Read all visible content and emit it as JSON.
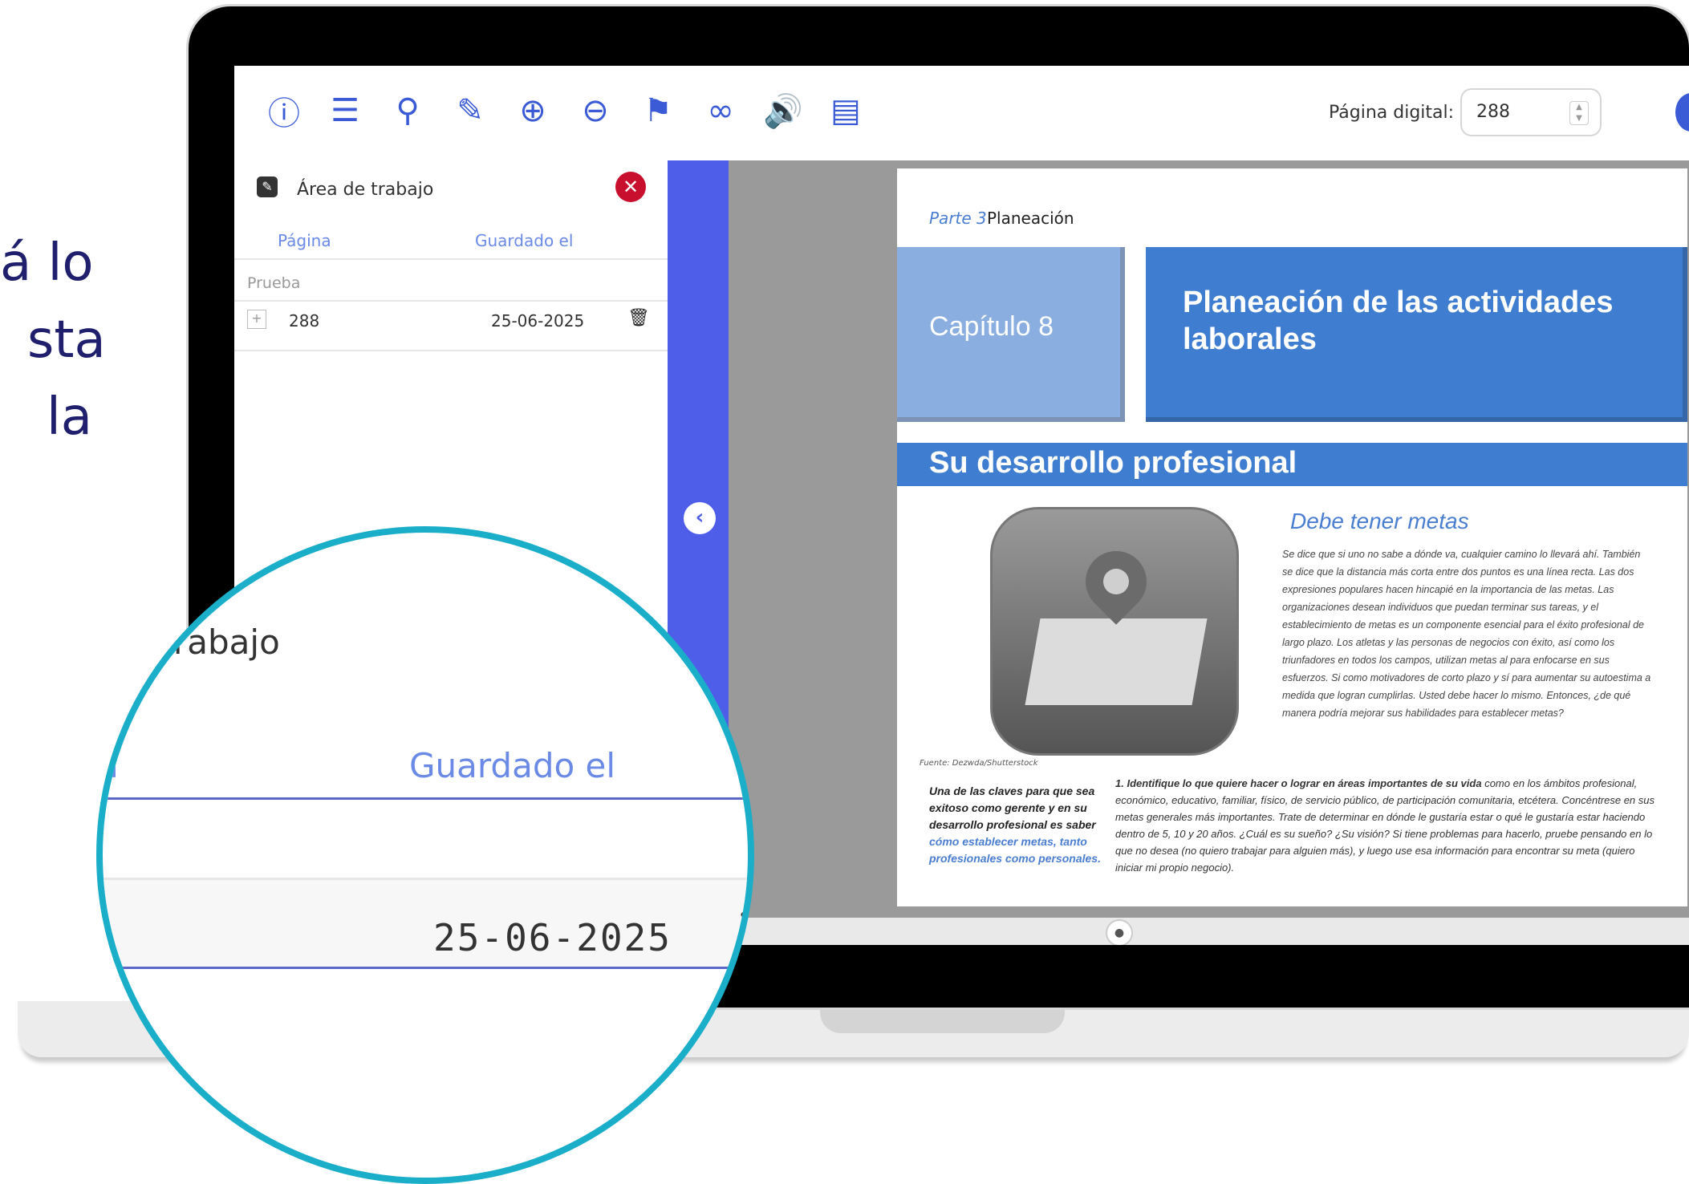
{
  "side_text": [
    "á lo",
    "sta",
    "la"
  ],
  "toolbar": {
    "icons": [
      "info-icon",
      "list-icon",
      "search-icon",
      "edit-icon",
      "zoom-in-icon",
      "zoom-out-icon",
      "bookmark-icon",
      "link-icon",
      "audio-icon",
      "translate-icon"
    ],
    "page_label": "Página digital:",
    "page_value": "288",
    "accent_color": "#3a5ad6"
  },
  "panel": {
    "title": "Área de trabajo",
    "col_page": "Página",
    "col_saved": "Guardado el",
    "group": "Prueba",
    "rows": [
      {
        "page": "288",
        "saved": "25-06-2025"
      }
    ],
    "strip_color": "#4f5ee8"
  },
  "book": {
    "parte": "Parte 3",
    "parte_sub": "Planeación",
    "chapter": "Capítulo 8",
    "chapter_title": "Planeación de las actividades laborales",
    "section": "Su desarrollo profesional",
    "sub_heading": "Debe tener metas",
    "body": "Se dice que si uno no sabe a dónde va, cualquier camino lo llevará ahí. También se dice que la distancia más corta entre dos puntos es una línea recta. Las dos expresiones populares hacen hincapié en la importancia de las metas. Las organizaciones desean individuos que puedan terminar sus tareas, y el establecimiento de metas es un componente esencial para el éxito profesional de largo plazo. Los atletas y las personas de negocios con éxito, así como los triunfadores en todos los campos, utilizan metas al para enfocarse en sus esfuerzos. Si como motivadores de corto plazo y sí para aumentar su autoestima a medida que logran cumplirlas. Usted debe hacer lo mismo. Entonces, ¿de qué manera podría mejorar sus habilidades para establecer metas?",
    "credit": "Fuente: Dezwda/Shutterstock",
    "key_text": "Una de las claves para que sea exitoso como gerente y en su desarrollo profesional es saber",
    "key_link": "cómo establecer metas, tanto profesionales como personales.",
    "list_lead": "1.   Identifique lo que quiere hacer o lograr en áreas importantes de su vida",
    "list_body": " como en los ámbitos profesional, económico, educativo, familiar, físico, de servicio público, de participación comunitaria, etcétera. Concéntrese en sus metas generales más importantes. Trate de determinar en dónde le gustaría estar o qué le gustaría estar haciendo dentro de 5, 10 y 20 años. ¿Cuál es su sueño? ¿Su visión? Si tiene problemas para hacerlo, pruebe pensando en lo que no desea (no quiero trabajar para alguien más), y luego use esa información para encontrar su meta (quiero iniciar mi propio negocio)."
  },
  "zoom": {
    "title": "rabajo",
    "head_left": "a",
    "head": "Guardado el",
    "date": "25-06-2025",
    "ring_color": "#1aaec9"
  }
}
